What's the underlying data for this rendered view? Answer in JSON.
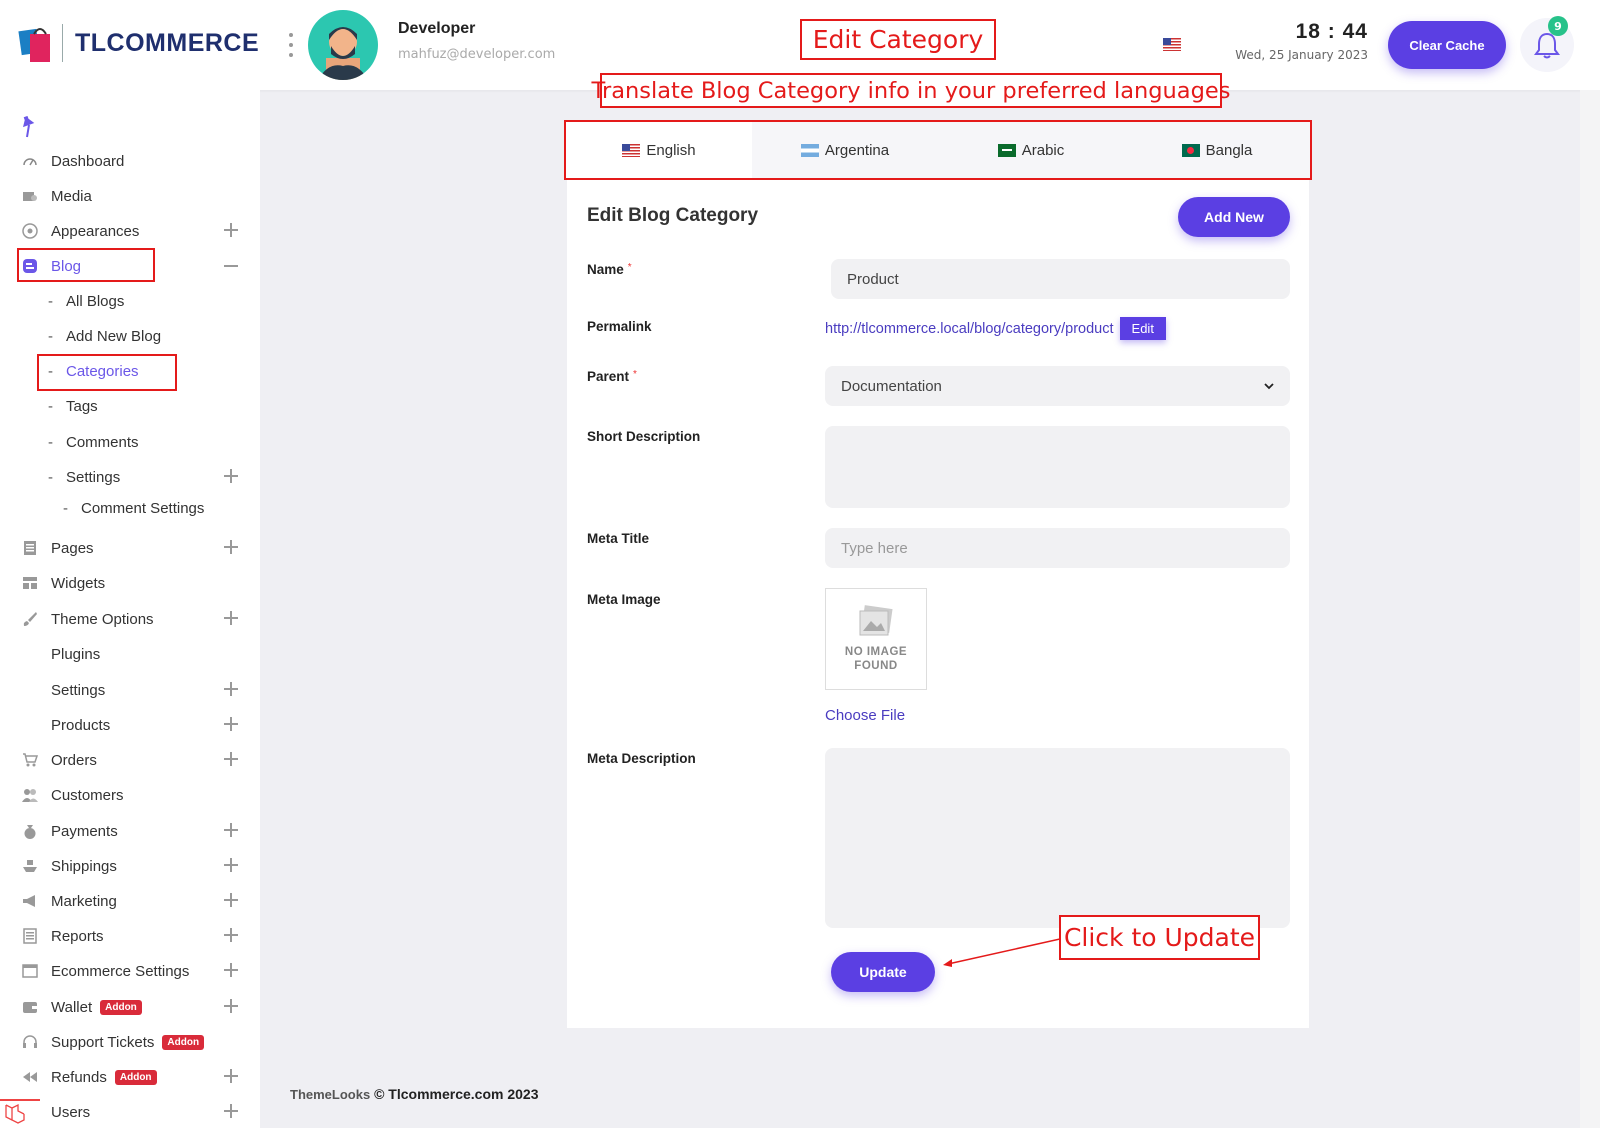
{
  "brand": {
    "logo_text": "TLCOMMERCE"
  },
  "user": {
    "name": "Developer",
    "email": "mahfuz@developer.com"
  },
  "annotations": {
    "edit_category": "Edit Category",
    "translate_info": "Translate Blog Category info in your preferred languages",
    "click_update": "Click to Update"
  },
  "clock": {
    "time": "18 : 44",
    "date": "Wed, 25 January 2023"
  },
  "header": {
    "clear_cache": "Clear Cache",
    "notification_count": "9"
  },
  "sidebar": {
    "items": [
      {
        "label": "Dashboard"
      },
      {
        "label": "Media"
      },
      {
        "label": "Appearances"
      },
      {
        "label": "Blog"
      },
      {
        "label": "Pages"
      },
      {
        "label": "Widgets"
      },
      {
        "label": "Theme Options"
      },
      {
        "label": "Plugins"
      },
      {
        "label": "Settings"
      },
      {
        "label": "Products"
      },
      {
        "label": "Orders"
      },
      {
        "label": "Customers"
      },
      {
        "label": "Payments"
      },
      {
        "label": "Shippings"
      },
      {
        "label": "Marketing"
      },
      {
        "label": "Reports"
      },
      {
        "label": "Ecommerce Settings"
      },
      {
        "label": "Wallet",
        "badge": "Addon"
      },
      {
        "label": "Support Tickets",
        "badge": "Addon"
      },
      {
        "label": "Refunds",
        "badge": "Addon"
      },
      {
        "label": "Users"
      }
    ],
    "blog_sub": [
      {
        "label": "All Blogs"
      },
      {
        "label": "Add New Blog"
      },
      {
        "label": "Categories"
      },
      {
        "label": "Tags"
      },
      {
        "label": "Comments"
      },
      {
        "label": "Settings"
      },
      {
        "label": "Comment Settings"
      }
    ]
  },
  "tabs": [
    {
      "label": "English"
    },
    {
      "label": "Argentina"
    },
    {
      "label": "Arabic"
    },
    {
      "label": "Bangla"
    }
  ],
  "form": {
    "title": "Edit Blog Category",
    "add_new": "Add New",
    "name_label": "Name",
    "name_value": "Product",
    "required_mark": "*",
    "permalink_label": "Permalink",
    "permalink_value": "http://tlcommerce.local/blog/category/product",
    "permalink_edit": "Edit",
    "parent_label": "Parent",
    "parent_value": "Documentation",
    "short_description_label": "Short Description",
    "meta_title_label": "Meta Title",
    "meta_title_placeholder": "Type here",
    "meta_image_label": "Meta Image",
    "no_image_line1": "NO IMAGE",
    "no_image_line2": "FOUND",
    "choose_file": "Choose File",
    "meta_description_label": "Meta Description",
    "update": "Update"
  },
  "footer": {
    "brand": "ThemeLooks",
    "copyright": "© Tlcommerce.com 2023"
  },
  "colors": {
    "primary": "#5b3fe3",
    "annotation": "#e41a1a",
    "badge_green": "#27c28a",
    "addon_red": "#d92b3a"
  }
}
